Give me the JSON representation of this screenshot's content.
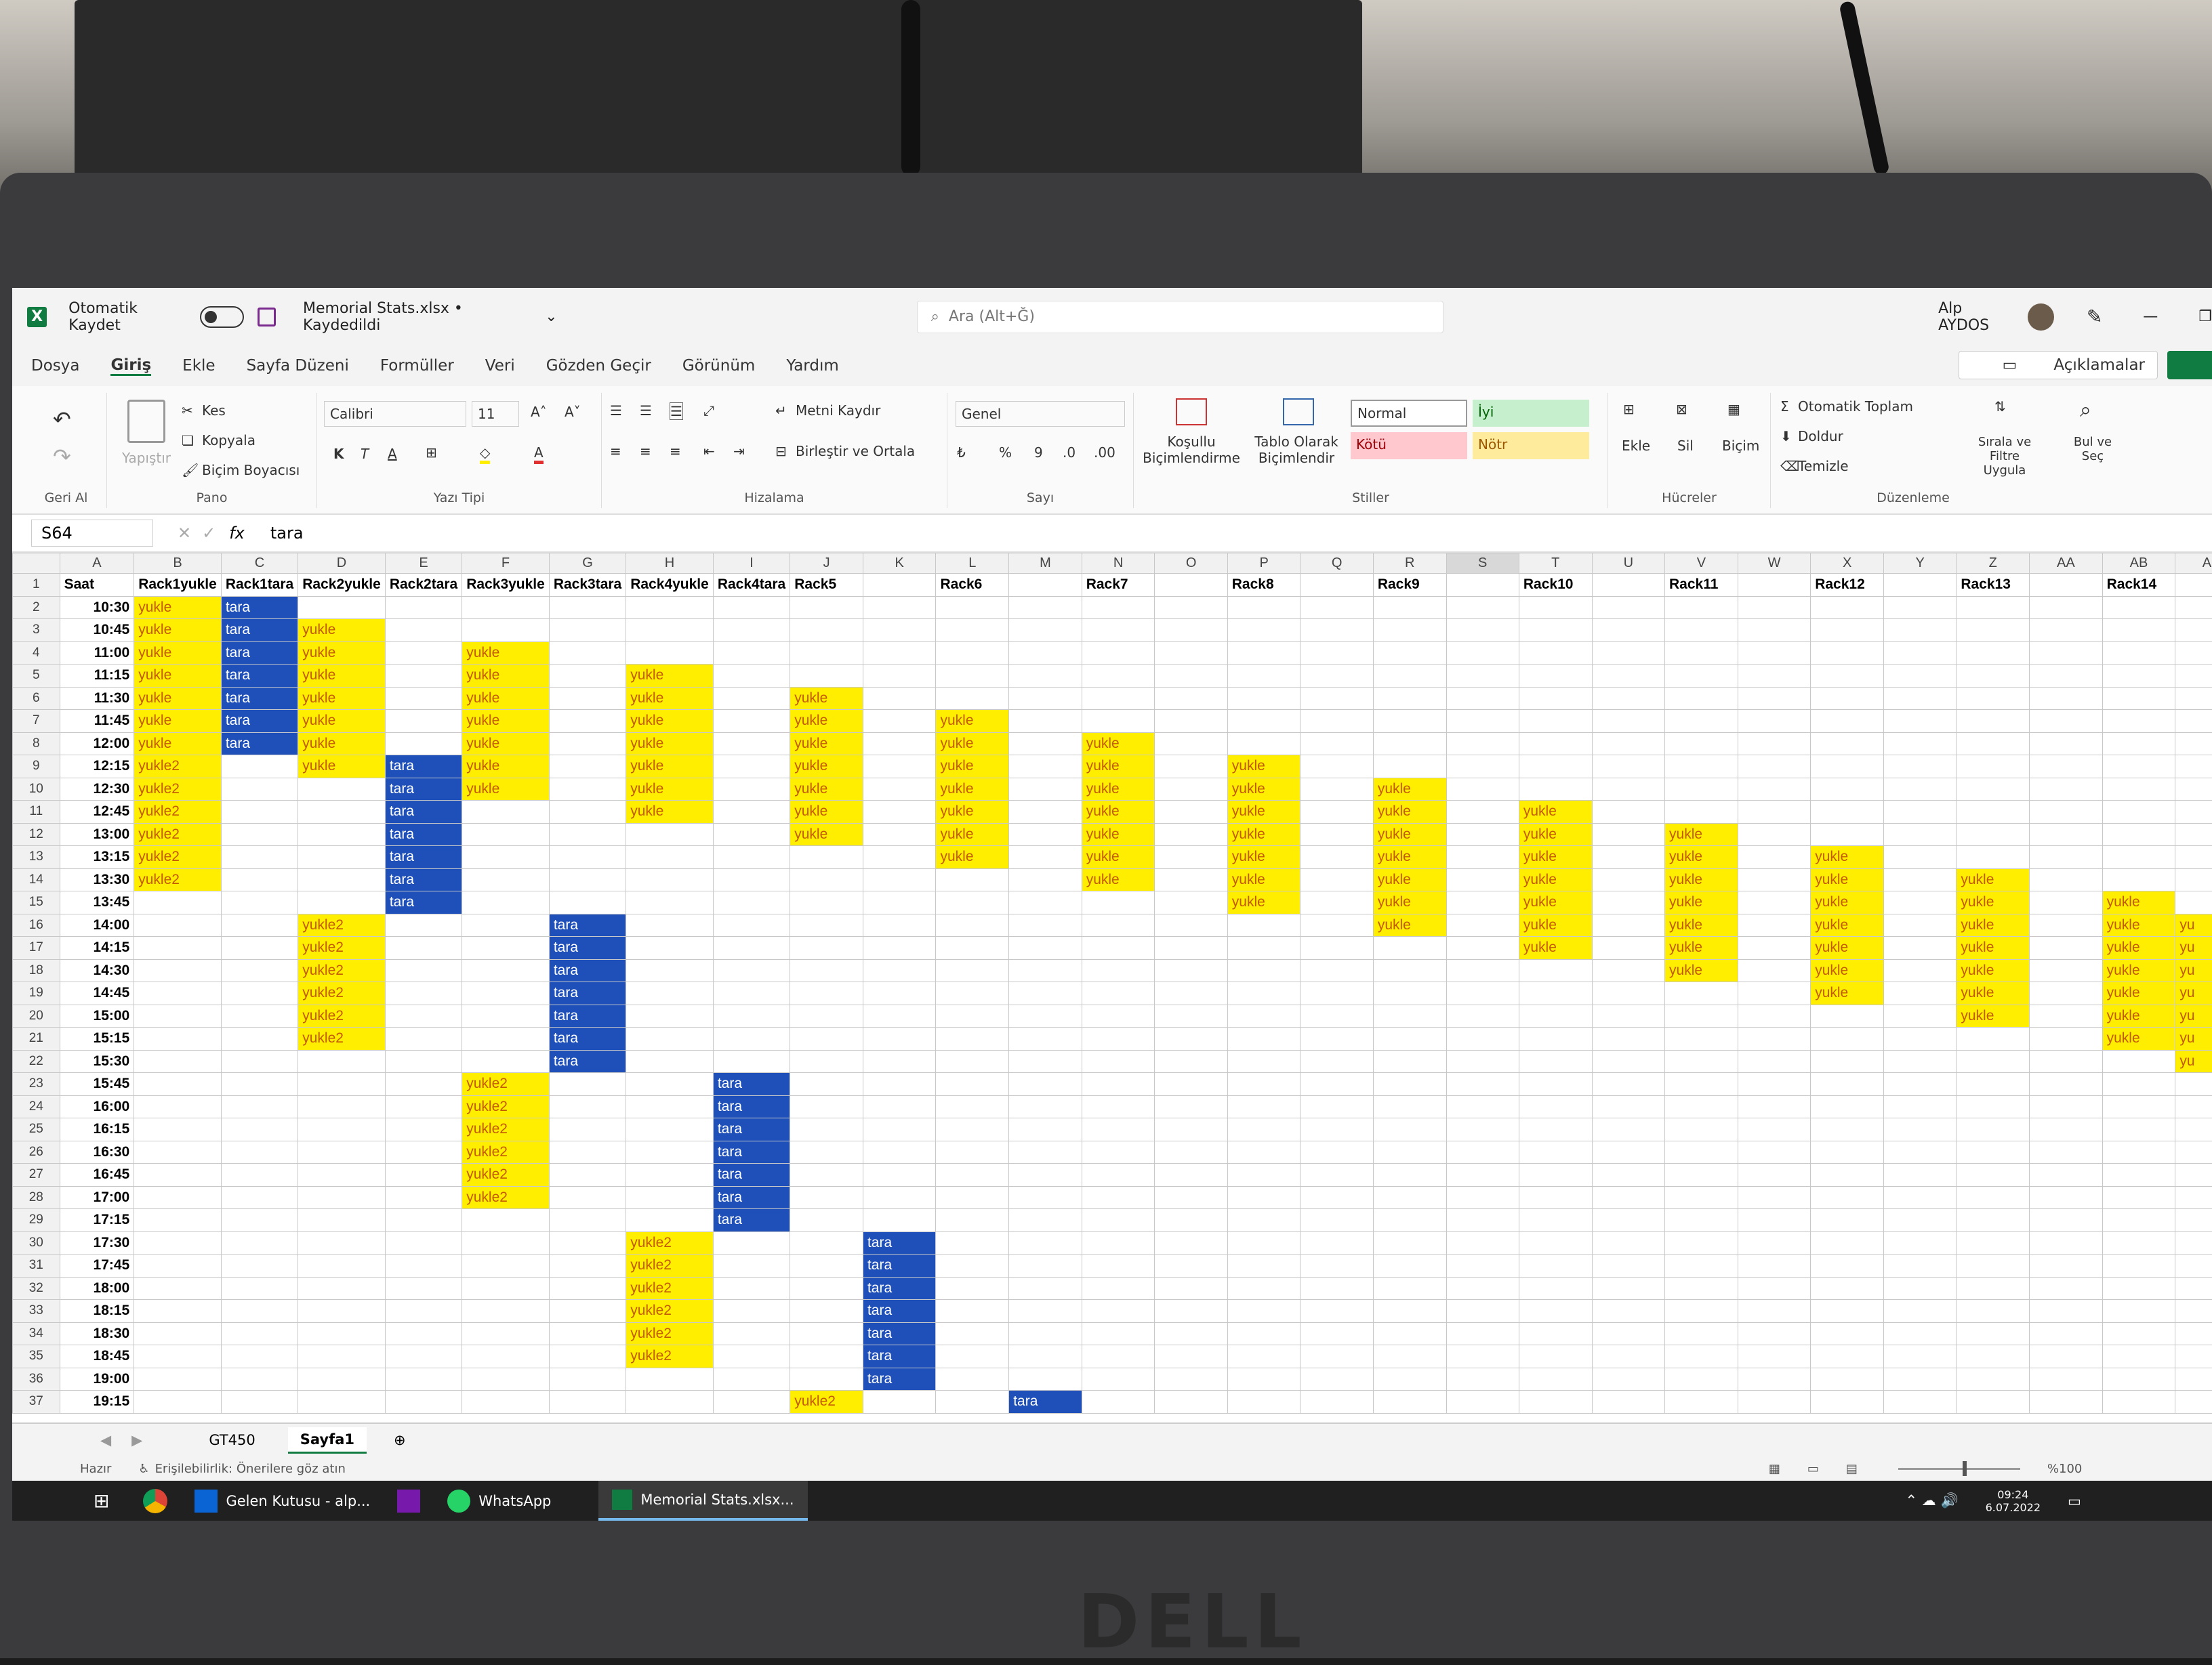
{
  "app": {
    "autosave_label": "Otomatik Kaydet",
    "title": "Memorial Stats.xlsx • Kaydedildi",
    "search_placeholder": "Ara (Alt+Ğ)",
    "user_name": "Alp AYDOS",
    "comments_label": "Açıklamalar"
  },
  "ribbon_tabs": [
    "Dosya",
    "Giriş",
    "Ekle",
    "Sayfa Düzeni",
    "Formüller",
    "Veri",
    "Gözden Geçir",
    "Görünüm",
    "Yardım"
  ],
  "ribbon": {
    "undo_group": "Geri Al",
    "clipboard": {
      "paste": "Yapıştır",
      "cut": "Kes",
      "copy": "Kopyala",
      "format_painter": "Biçim Boyacısı",
      "group": "Pano"
    },
    "font": {
      "name": "Calibri",
      "size": "11",
      "bold": "K",
      "italic": "T",
      "underline": "A",
      "color": "A",
      "group": "Yazı Tipi"
    },
    "alignment": {
      "wrap": "Metni Kaydır",
      "merge": "Birleştir ve Ortala",
      "group": "Hizalama"
    },
    "number": {
      "format": "Genel",
      "group": "Sayı"
    },
    "styles": {
      "conditional": "Koşullu Biçimlendirme",
      "table": "Tablo Olarak Biçimlendir",
      "normal": "Normal",
      "good": "İyi",
      "bad": "Kötü",
      "neutral": "Nötr",
      "group": "Stiller"
    },
    "cells": {
      "insert": "Ekle",
      "delete": "Sil",
      "format": "Biçim",
      "group": "Hücreler"
    },
    "editing": {
      "autosum": "Otomatik Toplam",
      "fill": "Doldur",
      "clear": "Temizle",
      "sort": "Sırala ve Filtre Uygula",
      "find": "Bul ve Seç",
      "group": "Düzenleme"
    }
  },
  "formula_bar": {
    "name_box": "S64",
    "fx": "fx",
    "content": "tara"
  },
  "columns": [
    "A",
    "B",
    "C",
    "D",
    "E",
    "F",
    "G",
    "H",
    "I",
    "J",
    "K",
    "L",
    "M",
    "N",
    "O",
    "P",
    "Q",
    "R",
    "S",
    "T",
    "U",
    "V",
    "W",
    "X",
    "Y",
    "Z",
    "AA",
    "AB",
    "AC"
  ],
  "header_row": [
    "Saat",
    "Rack1yukle",
    "Rack1tara",
    "Rack2yukle",
    "Rack2tara",
    "Rack3yukle",
    "Rack3tara",
    "Rack4yukle",
    "Rack4tara",
    "Rack5",
    "",
    "Rack6",
    "",
    "Rack7",
    "",
    "Rack8",
    "",
    "Rack9",
    "",
    "Rack10",
    "",
    "Rack11",
    "",
    "Rack12",
    "",
    "Rack13",
    "",
    "Rack14",
    ""
  ],
  "times": [
    "10:30",
    "10:45",
    "11:00",
    "11:15",
    "11:30",
    "11:45",
    "12:00",
    "12:15",
    "12:30",
    "12:45",
    "13:00",
    "13:15",
    "13:30",
    "13:45",
    "14:00",
    "14:15",
    "14:30",
    "14:45",
    "15:00",
    "15:15",
    "15:30",
    "15:45",
    "16:00",
    "16:15",
    "16:30",
    "16:45",
    "17:00",
    "17:15",
    "17:30",
    "17:45",
    "18:00",
    "18:15",
    "18:30",
    "18:45",
    "19:00",
    "19:15"
  ],
  "blocks": [
    {
      "col": 1,
      "from": 0,
      "to": 6,
      "text": "yukle",
      "type": "y"
    },
    {
      "col": 1,
      "from": 7,
      "to": 12,
      "text": "yukle2",
      "type": "y"
    },
    {
      "col": 2,
      "from": 0,
      "to": 6,
      "text": "tara",
      "type": "b"
    },
    {
      "col": 3,
      "from": 1,
      "to": 7,
      "text": "yukle",
      "type": "y"
    },
    {
      "col": 3,
      "from": 14,
      "to": 19,
      "text": "yukle2",
      "type": "y"
    },
    {
      "col": 4,
      "from": 7,
      "to": 13,
      "text": "tara",
      "type": "b"
    },
    {
      "col": 5,
      "from": 2,
      "to": 8,
      "text": "yukle",
      "type": "y"
    },
    {
      "col": 5,
      "from": 21,
      "to": 26,
      "text": "yukle2",
      "type": "y"
    },
    {
      "col": 6,
      "from": 14,
      "to": 20,
      "text": "tara",
      "type": "b"
    },
    {
      "col": 7,
      "from": 3,
      "to": 9,
      "text": "yukle",
      "type": "y"
    },
    {
      "col": 7,
      "from": 28,
      "to": 33,
      "text": "yukle2",
      "type": "y"
    },
    {
      "col": 8,
      "from": 21,
      "to": 27,
      "text": "tara",
      "type": "b"
    },
    {
      "col": 9,
      "from": 4,
      "to": 10,
      "text": "yukle",
      "type": "y"
    },
    {
      "col": 9,
      "from": 35,
      "to": 35,
      "text": "yukle2",
      "type": "y"
    },
    {
      "col": 10,
      "from": 28,
      "to": 34,
      "text": "tara",
      "type": "b"
    },
    {
      "col": 11,
      "from": 5,
      "to": 11,
      "text": "yukle",
      "type": "y"
    },
    {
      "col": 12,
      "from": 35,
      "to": 35,
      "text": "tara",
      "type": "b"
    },
    {
      "col": 13,
      "from": 6,
      "to": 12,
      "text": "yukle",
      "type": "y"
    },
    {
      "col": 15,
      "from": 7,
      "to": 13,
      "text": "yukle",
      "type": "y"
    },
    {
      "col": 17,
      "from": 8,
      "to": 14,
      "text": "yukle",
      "type": "y"
    },
    {
      "col": 19,
      "from": 9,
      "to": 15,
      "text": "yukle",
      "type": "y"
    },
    {
      "col": 21,
      "from": 10,
      "to": 16,
      "text": "yukle",
      "type": "y"
    },
    {
      "col": 23,
      "from": 11,
      "to": 17,
      "text": "yukle",
      "type": "y"
    },
    {
      "col": 25,
      "from": 12,
      "to": 18,
      "text": "yukle",
      "type": "y"
    },
    {
      "col": 27,
      "from": 13,
      "to": 19,
      "text": "yukle",
      "type": "y"
    },
    {
      "col": 28,
      "from": 14,
      "to": 20,
      "text": "yu",
      "type": "y"
    }
  ],
  "sheets": [
    "GT450",
    "Sayfa1"
  ],
  "status": {
    "ready": "Hazır",
    "accessibility": "Erişilebilirlik: Önerilere göz atın",
    "zoom": "%100"
  },
  "taskbar": {
    "items": [
      "Gelen Kutusu - alp...",
      "WhatsApp",
      "Memorial Stats.xlsx..."
    ],
    "time": "09:24",
    "date": "6.07.2022"
  },
  "colors": {
    "yellow": "#ffee00",
    "blue": "#1f4fb8",
    "excel_green": "#107c41"
  }
}
